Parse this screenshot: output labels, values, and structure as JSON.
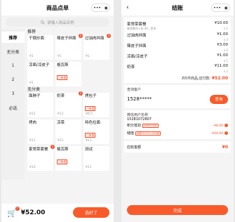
{
  "left": {
    "title": "商品点单",
    "capsule": {
      "dots": "•••",
      "circle": "◉"
    },
    "search_placeholder": "请输入商品名称",
    "sidebar": [
      "推荐",
      "无分类",
      "1",
      "2",
      "3",
      "必选"
    ],
    "sections": [
      {
        "title": "推荐",
        "items": [
          {
            "name": "干锅炒面",
            "price": "¥1",
            "tag": "",
            "badge": ""
          },
          {
            "name": "辣皮子拌面",
            "price": "¥1",
            "tag": "",
            "badge": "2"
          },
          {
            "name": "过油肉拌面",
            "price": "¥1",
            "tag": "",
            "badge": "3"
          },
          {
            "name": "凉面/凉皮子",
            "price": "¥1",
            "tag": "",
            "badge": ""
          },
          {
            "name": "格瓦斯",
            "price": "",
            "tag": "已售罄",
            "badge": ""
          }
        ]
      },
      {
        "title": "无分类",
        "items": [
          {
            "name": "面肺子",
            "price": "¥12",
            "tag": "",
            "badge": ""
          },
          {
            "name": "奶茶",
            "price": "¥11",
            "tag": "",
            "badge": "2"
          },
          {
            "name": "烤包子",
            "price": "¥6.5",
            "tag": "已售罄",
            "badge": ""
          },
          {
            "name": "烤肉",
            "price": "¥11",
            "tag": "",
            "badge": ""
          },
          {
            "name": "凉菜",
            "price": "¥11",
            "tag": "",
            "badge": ""
          },
          {
            "name": "特色拉面",
            "price": "¥11",
            "tag": "已售罄",
            "badge": ""
          },
          {
            "name": "家常菜套餐",
            "price": "¥10",
            "tag": "",
            "badge": "1"
          },
          {
            "name": "格瓦斯",
            "price": "",
            "tag": "已售罄",
            "badge": ""
          },
          {
            "name": "测试",
            "price": "¥11",
            "tag": "",
            "badge": ""
          }
        ]
      }
    ],
    "cart": {
      "count": "7",
      "total": "¥52.00",
      "done": "选好了"
    }
  },
  "right": {
    "title": "结账",
    "items": [
      {
        "name": "家常菜套餐",
        "price": "¥10.00",
        "sub": "雍杏酥炸+双-40...更多",
        "qty": "x 1"
      },
      {
        "name": "过油肉拌面",
        "price": "¥1.00",
        "sub": "",
        "qty": "x 3"
      },
      {
        "name": "辣皮子拌面",
        "price": "¥3.00",
        "sub": "",
        "qty": "x 2"
      },
      {
        "name": "凉面/凉皮子",
        "price": "¥1.00",
        "sub": "",
        "qty": "x 1"
      },
      {
        "name": "奶茶",
        "price": "¥11.00",
        "sub": "",
        "qty": "x 2"
      }
    ],
    "summary_prefix": "共5件商品,应付款:",
    "summary_total": "¥52.00",
    "member_label": "查询客户",
    "phone": "1528*****",
    "query_btn": "查询",
    "wechat_label": "微信用户名称",
    "wechat_phone": "15281072807",
    "points_label": "积分抵扣",
    "points_tag": "80积分可用",
    "points_value": "- ¥8.00",
    "balance_label": "储值",
    "balance_tag": "余额 ¥2019.00可用",
    "balance_value": "- ¥44.00",
    "due_label": "应收金额",
    "due_value": "¥0",
    "final_btn": "完成"
  }
}
